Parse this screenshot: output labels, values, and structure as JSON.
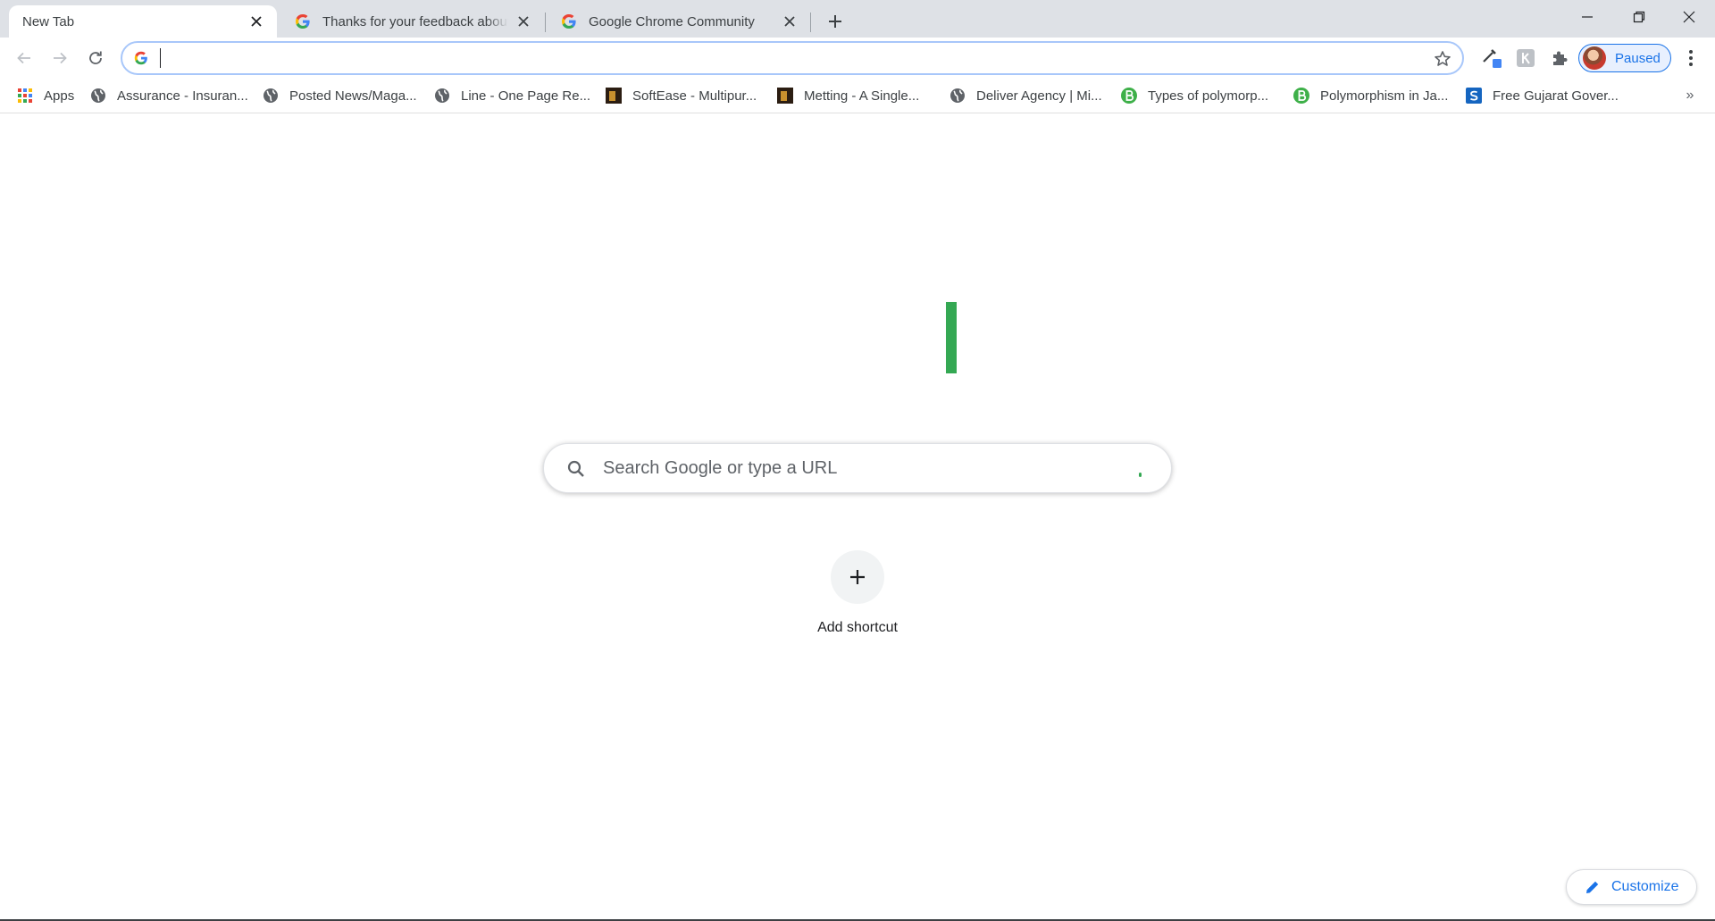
{
  "tabs": [
    {
      "title": "New Tab",
      "active": true
    },
    {
      "title": "Thanks for your feedback about Google Chrome",
      "active": false
    },
    {
      "title": "Google Chrome Community",
      "active": false
    }
  ],
  "omnibox": {
    "value": "",
    "placeholder": ""
  },
  "profile": {
    "label": "Paused"
  },
  "bookmarks": [
    {
      "label": "Apps",
      "icon": "apps-grid-icon"
    },
    {
      "label": "Assurance - Insuran...",
      "icon": "globe-icon"
    },
    {
      "label": "Posted News/Maga...",
      "icon": "globe-icon"
    },
    {
      "label": "Line - One Page Re...",
      "icon": "globe-icon"
    },
    {
      "label": "SoftEase - Multipur...",
      "icon": "site-thumbnail-icon"
    },
    {
      "label": "Metting - A Single...",
      "icon": "site-thumbnail-icon"
    },
    {
      "label": "Deliver Agency | Mi...",
      "icon": "globe-icon"
    },
    {
      "label": "Types of polymorp...",
      "icon": "b-green-icon"
    },
    {
      "label": "Polymorphism in Ja...",
      "icon": "b-green-icon"
    },
    {
      "label": "Free Gujarat Gover...",
      "icon": "s-blue-icon"
    }
  ],
  "ntp": {
    "search_placeholder": "Search Google or type a URL",
    "add_shortcut_label": "Add shortcut",
    "customize_label": "Customize"
  },
  "colors": {
    "accent_blue": "#1a73e8",
    "logo_green": "#34a853",
    "tabstrip": "#dee1e6"
  }
}
